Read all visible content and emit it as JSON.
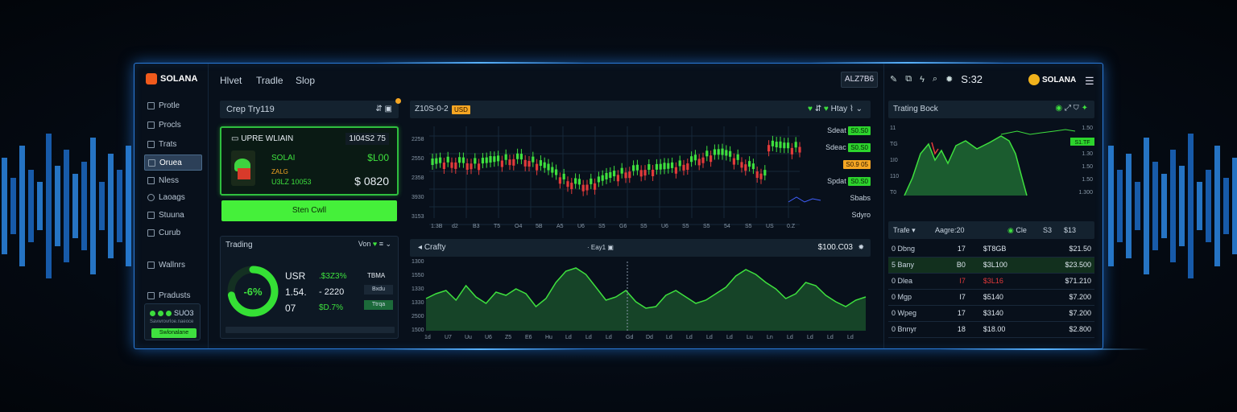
{
  "sidebar": {
    "logo": "SOLANA",
    "items": [
      {
        "label": "Protle",
        "icon": "profile-icon"
      },
      {
        "label": "Procls",
        "icon": "portfolio-icon"
      },
      {
        "label": "Trats",
        "icon": "trade-icon"
      },
      {
        "label": "Oruea",
        "icon": "orders-icon",
        "active": true
      },
      {
        "label": "Nless",
        "icon": "news-icon"
      },
      {
        "label": "Laoags",
        "icon": "settings-icon"
      },
      {
        "label": "Stuuna",
        "icon": "stats-icon"
      },
      {
        "label": "Curub",
        "icon": "club-icon"
      },
      {
        "label": "Wallnrs",
        "icon": "wallet-icon"
      },
      {
        "label": "Pradusts",
        "icon": "products-icon"
      }
    ],
    "promo": {
      "title": "SUO3",
      "subtitle": "Savwrovrloe.naeoce",
      "button": "Swlonalane"
    }
  },
  "topnav": {
    "items": [
      "Hlvet",
      "Tradle",
      "Slop"
    ],
    "box": "ALZ7B6",
    "ticker": "S:32",
    "right_logo": "SOLANA"
  },
  "wallet": {
    "header": "Crep Try119",
    "title": "UPRE WLIAIN",
    "balance": "1I04S2 75",
    "coin": "SOLAI",
    "coin_value": "$L00",
    "line2": "ZALG",
    "line3": "U3LZ 10053",
    "amount": "$ 0820",
    "button": "Sten Cwll"
  },
  "trading": {
    "title": "Trading",
    "right": "Von",
    "gauge": "-6%",
    "gauge_percent": 0.72,
    "rows": [
      {
        "a": "USR",
        "b": ".$3Z3%",
        "c": "TBMA"
      },
      {
        "a": "1.54.",
        "b": "- 2220",
        "c": "Bxdu"
      },
      {
        "a": "07",
        "b": "$D.7%",
        "c": "Ttrqa"
      }
    ]
  },
  "chart": {
    "date": "Z10S-0-2",
    "badge": "USD",
    "controls": "Htay",
    "y_left": [
      "2258",
      "2550",
      "2358",
      "3930",
      "3153"
    ],
    "labels_right": [
      {
        "text": "Sdeat",
        "badge": "S0.S0",
        "color": "green"
      },
      {
        "text": "Sdeac",
        "badge": "S0.S0",
        "color": "green"
      },
      {
        "text": "",
        "badge": "S0.9 05",
        "color": "orange"
      },
      {
        "text": "Spdat",
        "badge": "S0.S0",
        "color": "green"
      },
      {
        "text": "Sbabs",
        "badge": "",
        "color": ""
      },
      {
        "text": "Sdyro",
        "badge": "",
        "color": ""
      }
    ],
    "x_labels": [
      "1:3B",
      "d2",
      "B3",
      "T5",
      "O4",
      "5B",
      "A5",
      "U6",
      "S5",
      "G6",
      "S5",
      "U6",
      "S5",
      "S5",
      "54",
      "S5",
      "US",
      "0.Z"
    ]
  },
  "area": {
    "title": "Crafty",
    "mid": "Eay1",
    "value": "$100.C03",
    "y_left": [
      "1300",
      "1550",
      "1330",
      "1330",
      "2500",
      "1500"
    ],
    "x_labels": [
      "1d",
      "U7",
      "Uu",
      "U6",
      "Z5",
      "E6",
      "Hu",
      "Ld",
      "Ld",
      "Ld",
      "Gd",
      "Dd",
      "Ld",
      "Ld",
      "Ld",
      "Ld",
      "Lu",
      "Ln",
      "Ld",
      "Ld",
      "Ld",
      "Ld"
    ]
  },
  "trading_book": {
    "title": "Trating Bock",
    "y_left": [
      "11",
      "TG",
      "1I0",
      "110",
      "T0"
    ],
    "y_right": [
      "1.50",
      "1.50",
      "1.30",
      "1.50",
      "1.50",
      "1.300"
    ],
    "badge": "S1.TF"
  },
  "trades": {
    "headers": [
      "Trafe",
      "Aagre:20",
      "Cle",
      "S3",
      "$13"
    ],
    "rows": [
      {
        "name": "0 Dbng",
        "qty": "17",
        "price": "$T8GB",
        "total": "$21.50",
        "color": "white"
      },
      {
        "name": "5 Bany",
        "qty": "B0",
        "price": "$3L100",
        "total": "$23.500",
        "color": "white",
        "hl": true
      },
      {
        "name": "0 Dlea",
        "qty": "I7",
        "price": "$3L16",
        "total": "$71.210",
        "color": "red"
      },
      {
        "name": "0 Mgp",
        "qty": "I7",
        "price": "$5140",
        "total": "$7.200",
        "color": "white"
      },
      {
        "name": "0 Wpeg",
        "qty": "17",
        "price": "$3140",
        "total": "$7.200",
        "color": "white"
      },
      {
        "name": "0 Bnnyr",
        "qty": "18",
        "price": "$18.00",
        "total": "$2.800",
        "color": "white"
      }
    ]
  },
  "colors": {
    "accent": "#2a7ad8",
    "green": "#3ee03e",
    "red": "#e23a3a",
    "orange": "#f5a623"
  }
}
